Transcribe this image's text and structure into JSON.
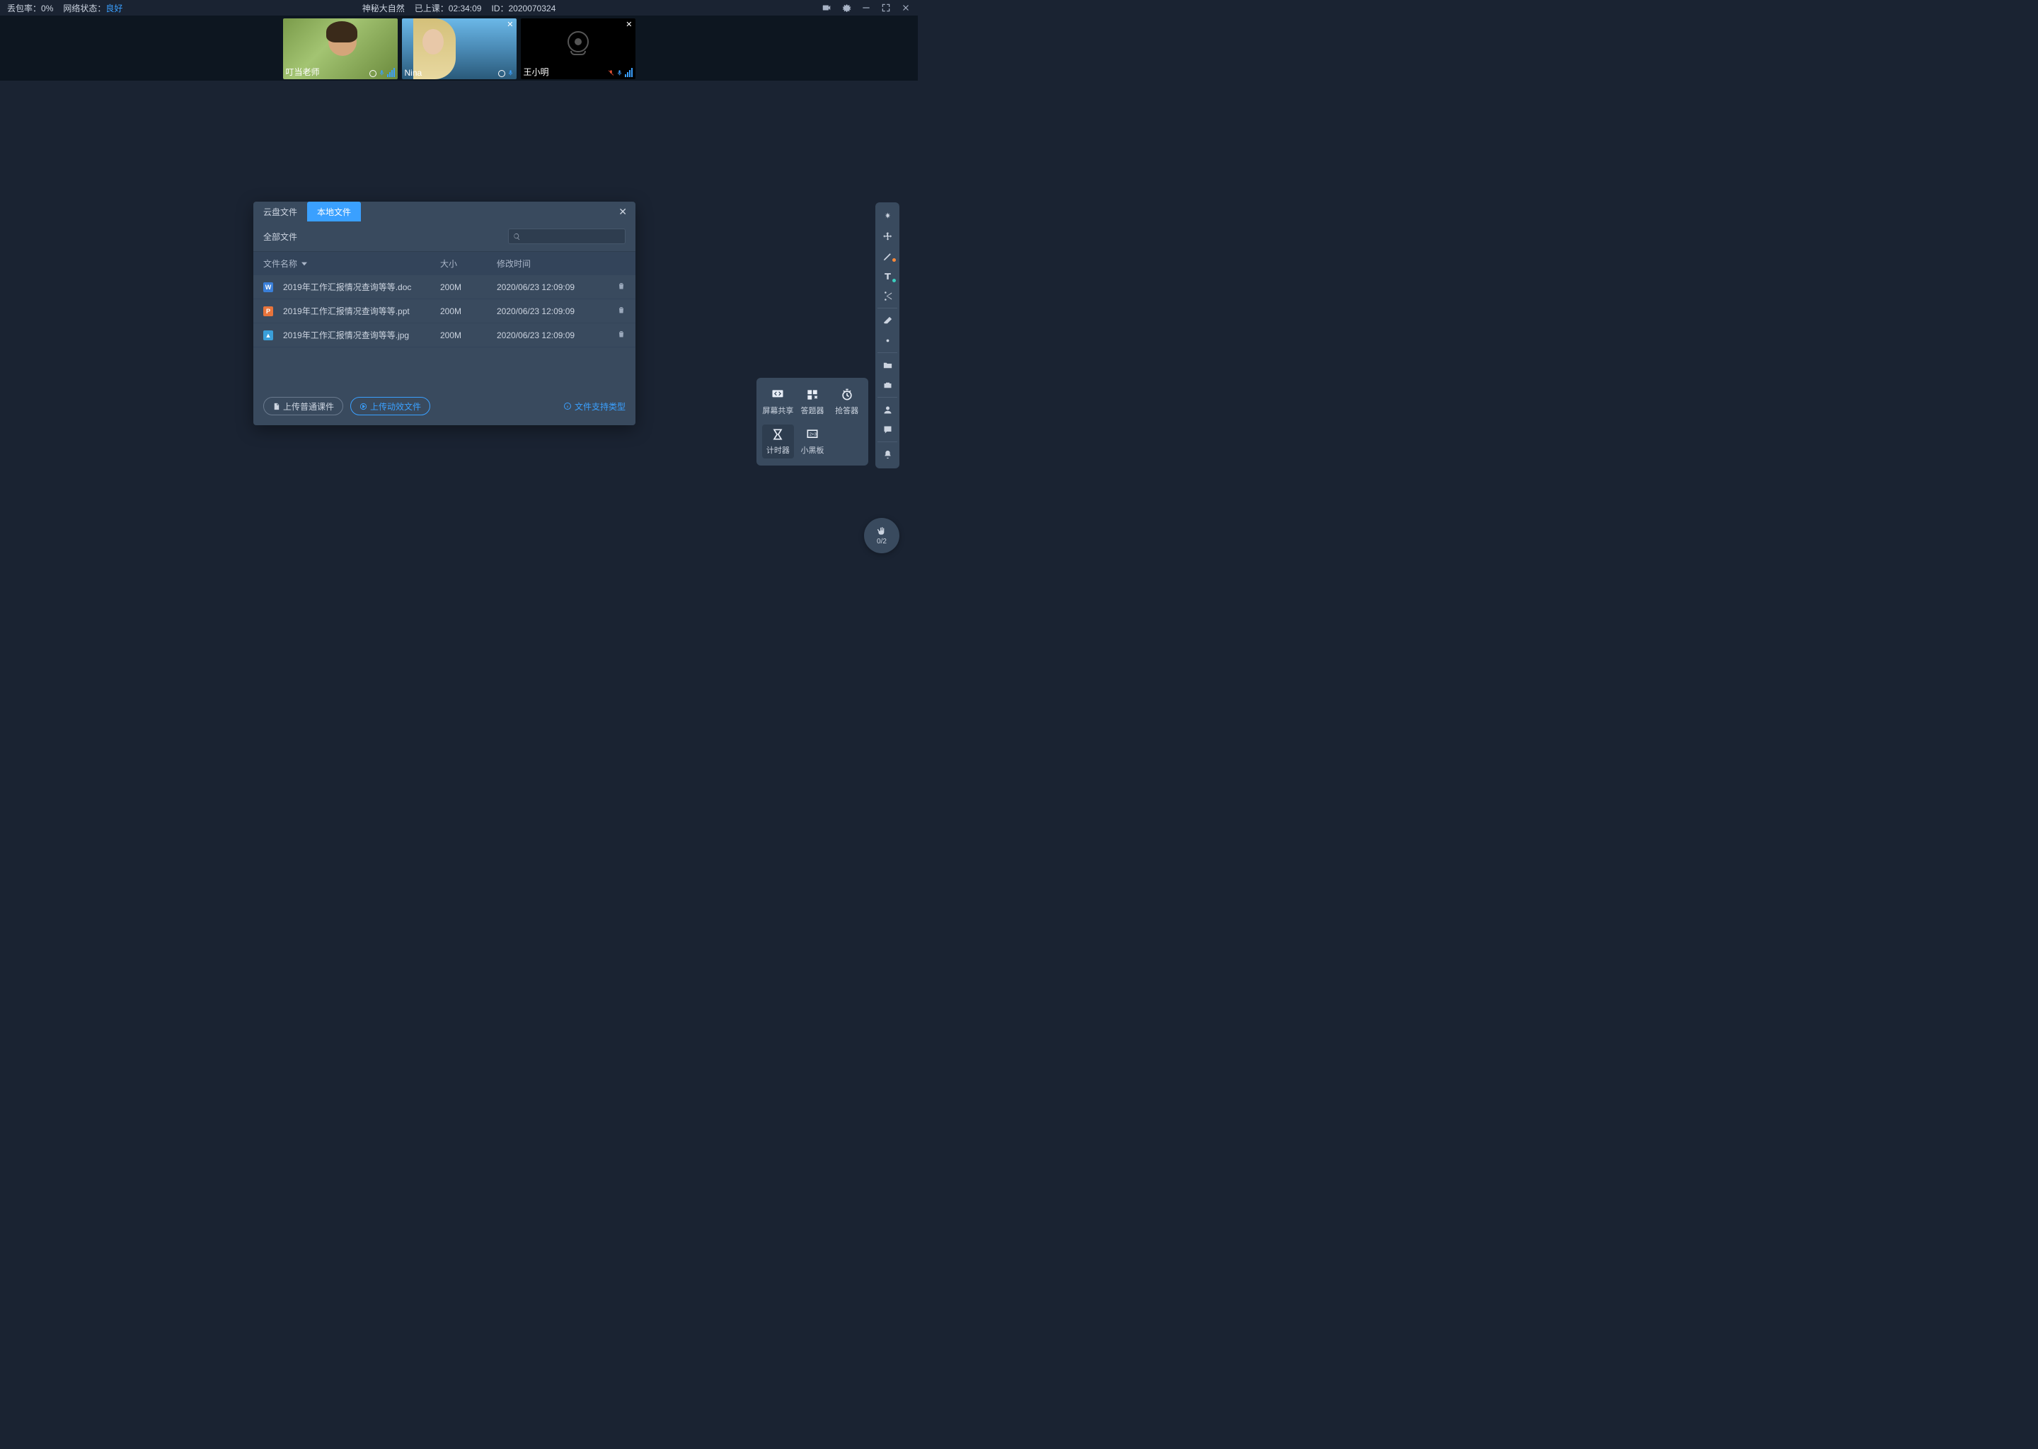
{
  "topbar": {
    "packet_loss_label": "丢包率：",
    "packet_loss_value": "0%",
    "network_label": "网络状态：",
    "network_value": "良好",
    "title": "神秘大自然",
    "class_time_label": "已上课：",
    "class_time_value": "02:34:09",
    "id_label": "ID：",
    "id_value": "2020070324"
  },
  "videos": [
    {
      "name": "叮当老师",
      "closable": false,
      "cam_off": false,
      "mic_muted": false
    },
    {
      "name": "Nina",
      "closable": true,
      "cam_off": false,
      "mic_muted": false
    },
    {
      "name": "王小明",
      "closable": true,
      "cam_off": true,
      "mic_muted": true
    }
  ],
  "dialog": {
    "tab_cloud": "云盘文件",
    "tab_local": "本地文件",
    "breadcrumb": "全部文件",
    "col_name": "文件名称",
    "col_size": "大小",
    "col_mtime": "修改时间",
    "files": [
      {
        "icon": "w",
        "icon_letter": "W",
        "name": "2019年工作汇报情况查询等等.doc",
        "size": "200M",
        "mtime": "2020/06/23 12:09:09"
      },
      {
        "icon": "p",
        "icon_letter": "P",
        "name": "2019年工作汇报情况查询等等.ppt",
        "size": "200M",
        "mtime": "2020/06/23 12:09:09"
      },
      {
        "icon": "i",
        "icon_letter": "▲",
        "name": "2019年工作汇报情况查询等等.jpg",
        "size": "200M",
        "mtime": "2020/06/23 12:09:09"
      }
    ],
    "btn_upload_normal": "上传普通课件",
    "btn_upload_anim": "上传动效文件",
    "link_supported": "文件支持类型"
  },
  "teach": {
    "screen_share": "屏幕共享",
    "answer": "答题器",
    "race": "抢答器",
    "timer": "计时器",
    "blackboard": "小黑板"
  },
  "hand_count": "0/2"
}
